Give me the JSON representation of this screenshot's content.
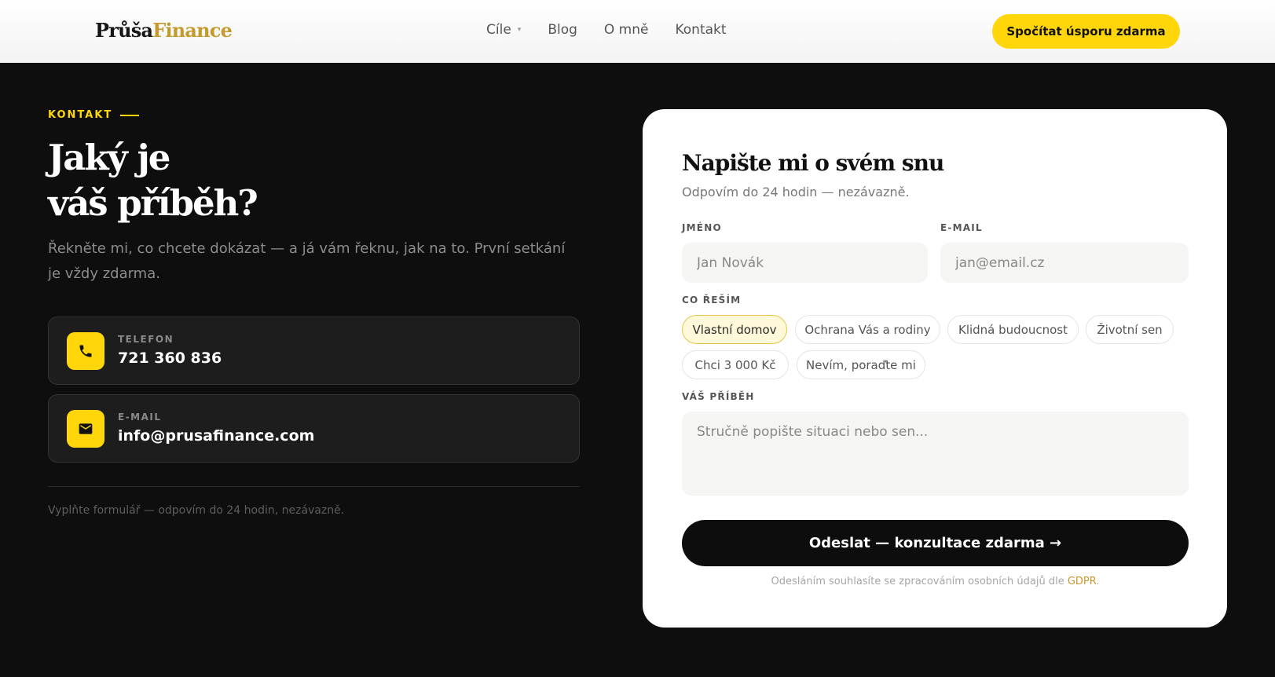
{
  "header": {
    "logo_part1": "Průša",
    "logo_part2": "Finance",
    "nav": [
      {
        "label": "Cíle"
      },
      {
        "label": "Blog"
      },
      {
        "label": "O mně"
      },
      {
        "label": "Kontakt"
      }
    ],
    "cta_label": "Spočítat úsporu zdarma"
  },
  "contact": {
    "eyebrow": "KONTAKT",
    "headline_line1": "Jaký je",
    "headline_line2": "váš příběh?",
    "lead": "Řekněte mi, co chcete dokázat — a já vám řeknu, jak na to. První setkání je vždy zdarma.",
    "phone_label": "TELEFON",
    "phone_value": "721 360 836",
    "email_label": "E-MAIL",
    "email_value": "info@prusafinance.com",
    "footnote": "Vyplňte formulář — odpovím do 24 hodin, nezávazně."
  },
  "form": {
    "title": "Napište mi o svém snu",
    "subtitle": "Odpovím do 24 hodin — nezávazně.",
    "name_label": "JMÉNO",
    "name_placeholder": "Jan Novák",
    "email_label": "E-MAIL",
    "email_placeholder": "jan@email.cz",
    "topic_label": "CO ŘEŠÍM",
    "chips": [
      {
        "label": "Vlastní domov",
        "selected": true
      },
      {
        "label": "Ochrana Vás a rodiny",
        "selected": false
      },
      {
        "label": "Klidná budoucnost",
        "selected": false
      },
      {
        "label": "Životní sen",
        "selected": false
      },
      {
        "label": "Chci 3 000 Kč",
        "selected": false
      },
      {
        "label": "Nevím, poraďte mi",
        "selected": false
      }
    ],
    "story_label": "VÁŠ PŘÍBĚH",
    "story_placeholder": "Stručně popište situaci nebo sen...",
    "submit_label": "Odeslat — konzultace zdarma →",
    "consent_text": "Odesláním souhlasíte se zpracováním osobních údajů dle ",
    "consent_link": "GDPR",
    "consent_end": "."
  },
  "colors": {
    "accent": "#ffd60a",
    "brand_gold": "#c49a2c",
    "background": "#0e0e0e"
  },
  "icons": {
    "phone": "phone-icon",
    "email": "envelope-icon",
    "nav_dropdown": "caret-down-icon"
  }
}
